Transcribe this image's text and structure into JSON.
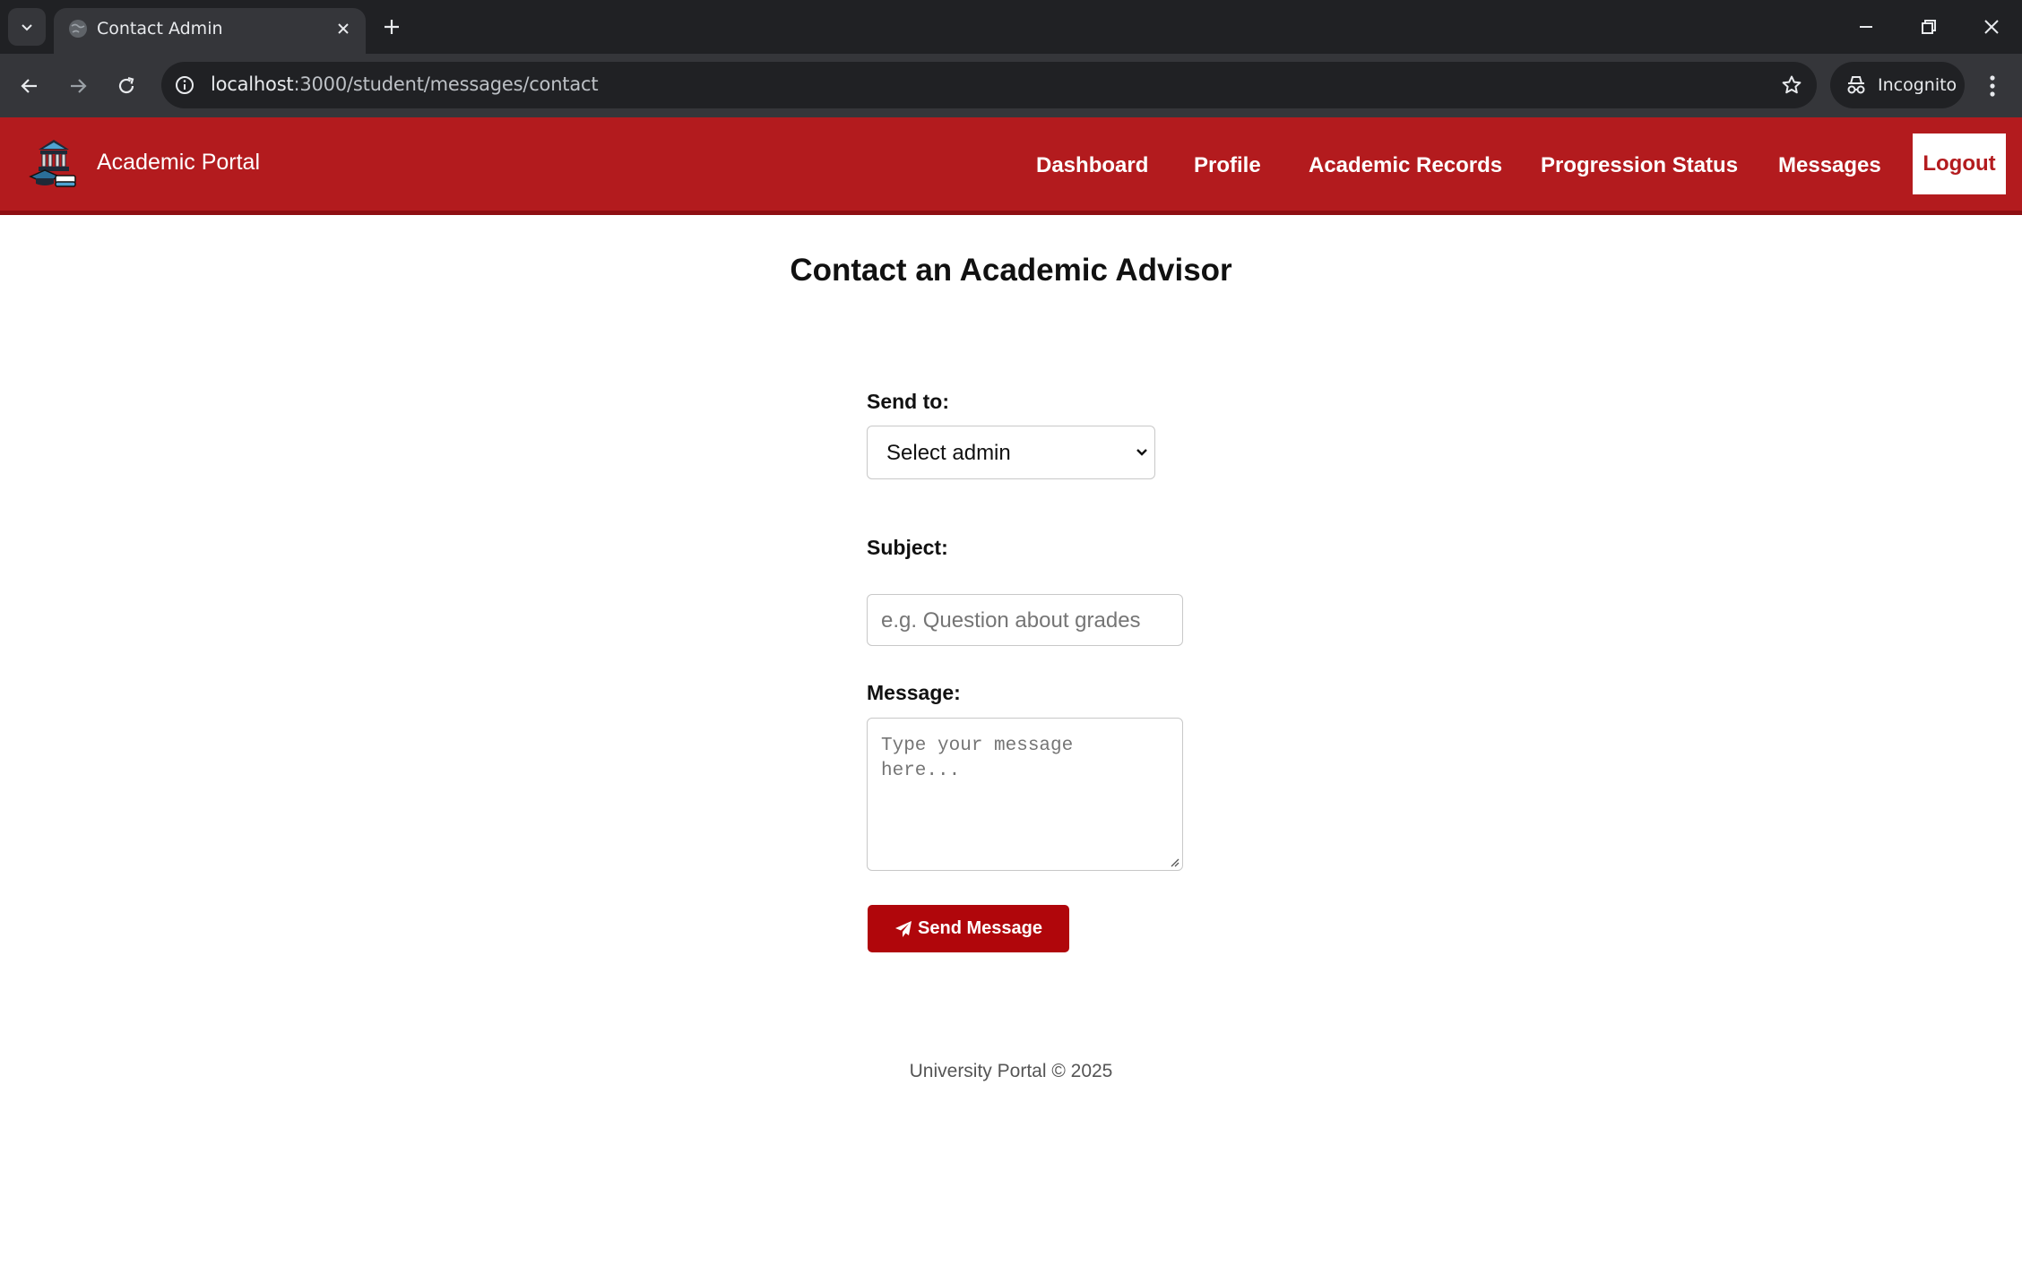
{
  "browser": {
    "tab_title": "Contact Admin",
    "url_host": "localhost",
    "url_path": ":3000/student/messages/contact",
    "incognito_label": "Incognito",
    "icons": [
      "tab-search-icon",
      "globe-icon",
      "close-icon",
      "plus-icon",
      "minimize-icon",
      "restore-icon",
      "back-arrow-icon",
      "forward-arrow-icon",
      "reload-icon",
      "info-icon",
      "star-icon",
      "incognito-icon",
      "kebab-menu-icon"
    ]
  },
  "header": {
    "brand": "Academic Portal",
    "logo_icon": "university-building-icon",
    "nav": [
      {
        "label": "Dashboard"
      },
      {
        "label": "Profile"
      },
      {
        "label": "Academic Records"
      },
      {
        "label": "Progression Status"
      },
      {
        "label": "Messages"
      }
    ],
    "logout": "Logout",
    "colors": {
      "header_bg": "#b31b1e",
      "header_border": "#8e0f12"
    }
  },
  "main": {
    "title": "Contact an Academic Advisor",
    "send_to": {
      "label": "Send to:",
      "selected": "Select admin"
    },
    "subject": {
      "label": "Subject:",
      "placeholder": "e.g. Question about grades",
      "value": ""
    },
    "message": {
      "label": "Message:",
      "placeholder": "Type your message here...",
      "value": ""
    },
    "submit": {
      "label": "Send Message",
      "icon": "paper-plane-icon",
      "color": "#b0060b"
    }
  },
  "footer": {
    "text": "University Portal © 2025"
  }
}
